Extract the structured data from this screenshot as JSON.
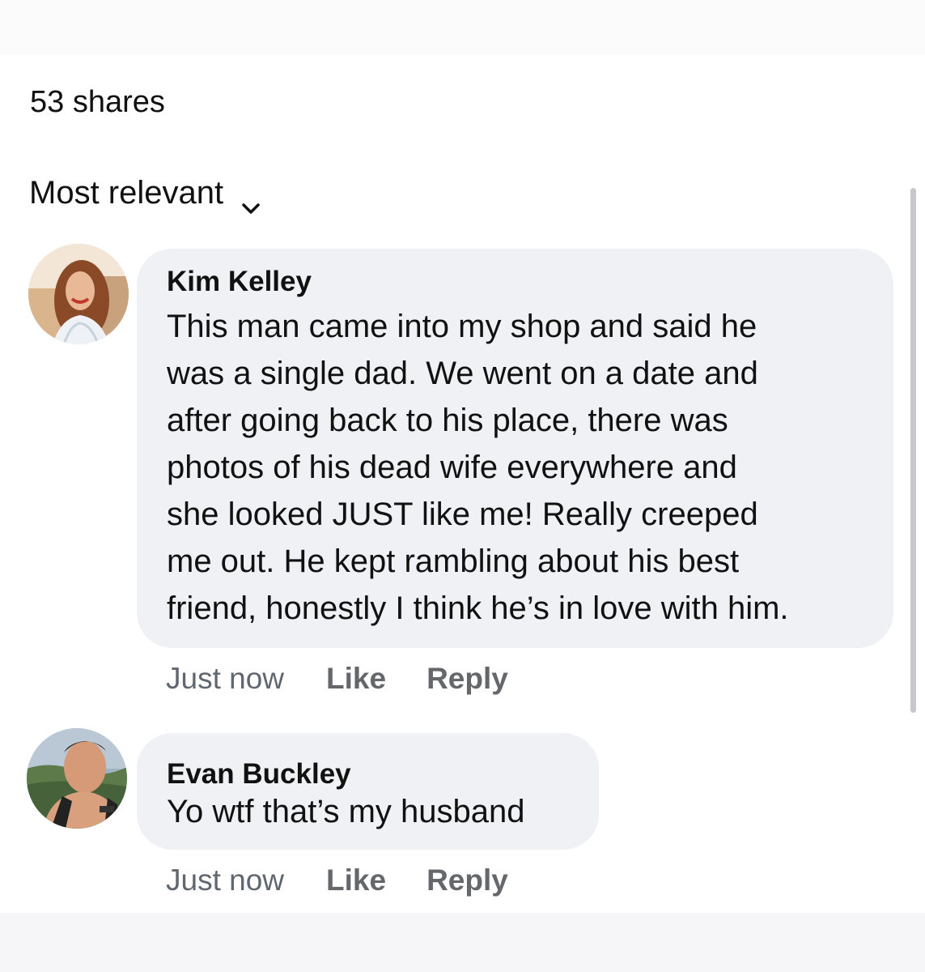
{
  "shares_label": "53 shares",
  "sort": {
    "label": "Most relevant",
    "icon": "chevron-down-icon"
  },
  "comments": [
    {
      "author": "Kim Kelley",
      "text": "This man came into my shop and said he\nwas a single dad. We went on a date and\nafter going back to his place, there was\nphotos of his dead wife everywhere and\nshe looked JUST like me! Really creeped\nme out. He kept rambling about his best\nfriend, honestly I think he’s in love with him.",
      "time": "Just now",
      "like_label": "Like",
      "reply_label": "Reply"
    },
    {
      "author": "Evan Buckley",
      "text": "Yo wtf that’s my husband",
      "time": "Just now",
      "like_label": "Like",
      "reply_label": "Reply"
    }
  ],
  "colors": {
    "bubble": "#f0f1f5",
    "meta_text": "#65676b",
    "text": "#111111"
  }
}
